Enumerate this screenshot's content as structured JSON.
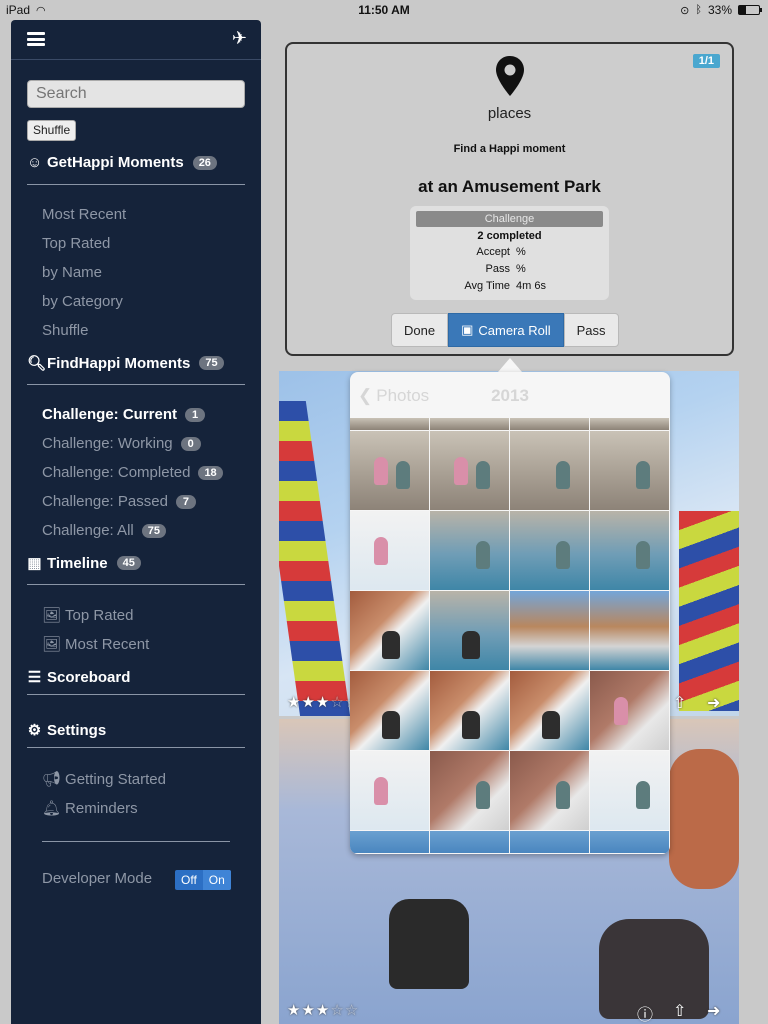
{
  "status_bar": {
    "device": "iPad",
    "time": "11:50 AM",
    "battery": "33%",
    "battery_level": 0.33
  },
  "sidebar": {
    "search_placeholder": "Search",
    "shuffle_label": "Shuffle",
    "get_moments": {
      "label": "GetHappi Moments",
      "count": "26",
      "items": [
        "Most Recent",
        "Top Rated",
        "by Name",
        "by Category",
        "Shuffle"
      ]
    },
    "find_moments": {
      "label": "FindHappi Moments",
      "count": "75",
      "items": [
        {
          "label": "Challenge: Current",
          "count": "1"
        },
        {
          "label": "Challenge: Working",
          "count": "0"
        },
        {
          "label": "Challenge: Completed",
          "count": "18"
        },
        {
          "label": "Challenge: Passed",
          "count": "7"
        },
        {
          "label": "Challenge: All",
          "count": "75"
        }
      ]
    },
    "timeline": {
      "label": "Timeline",
      "count": "45",
      "items": [
        "Top Rated",
        "Most Recent"
      ]
    },
    "scoreboard": {
      "label": "Scoreboard"
    },
    "settings": {
      "label": "Settings",
      "items": [
        "Getting Started",
        "Reminders"
      ]
    },
    "developer_mode": {
      "label": "Developer Mode",
      "off": "Off",
      "on": "On"
    }
  },
  "challenge_card": {
    "counter": "1/1",
    "category": "places",
    "prompt": "Find a Happi moment",
    "location": "at an Amusement Park",
    "stats": {
      "header": "Challenge",
      "completed": "2 completed",
      "accept_label": "Accept",
      "accept_value": "%",
      "pass_label": "Pass",
      "pass_value": "%",
      "avg_time_label": "Avg Time",
      "avg_time_value": "4m 6s"
    },
    "buttons": {
      "done": "Done",
      "camera_roll": "Camera Roll",
      "pass": "Pass"
    }
  },
  "photo_picker": {
    "back_label": "Photos",
    "title": "2013"
  },
  "photos": [
    {
      "rating": 3
    },
    {
      "rating": 3
    }
  ],
  "colors": {
    "sidebar_bg": "#15233a",
    "accent": "#3a78b8",
    "badge": "#6d7480",
    "counter": "#4aa7cf"
  }
}
